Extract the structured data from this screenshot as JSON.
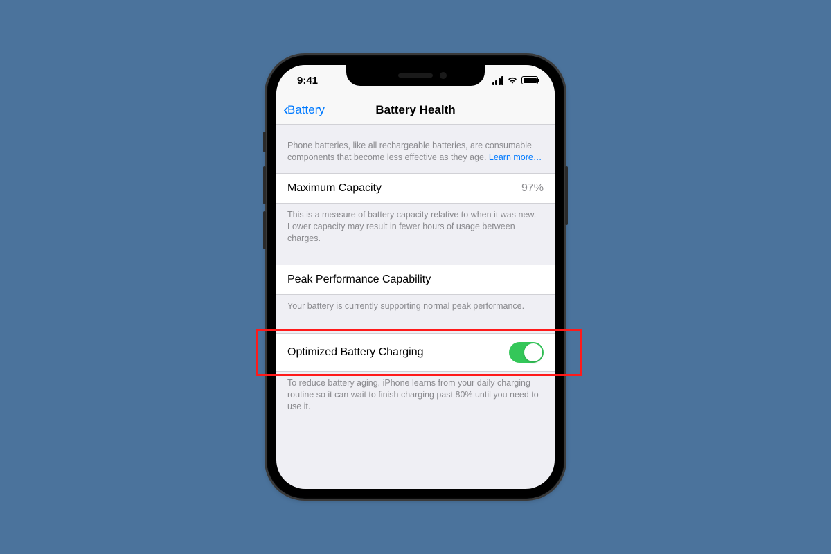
{
  "status": {
    "time": "9:41"
  },
  "nav": {
    "back": "Battery",
    "title": "Battery Health"
  },
  "intro": {
    "text": "Phone batteries, like all rechargeable batteries, are consumable components that become less effective as they age. ",
    "link": "Learn more…"
  },
  "capacity": {
    "label": "Maximum Capacity",
    "value": "97%",
    "footer": "This is a measure of battery capacity relative to when it was new. Lower capacity may result in fewer hours of usage between charges."
  },
  "peak": {
    "label": "Peak Performance Capability",
    "footer": "Your battery is currently supporting normal peak performance."
  },
  "optimized": {
    "label": "Optimized Battery Charging",
    "toggle": true,
    "footer": "To reduce battery aging, iPhone learns from your daily charging routine so it can wait to finish charging past 80% until you need to use it."
  }
}
